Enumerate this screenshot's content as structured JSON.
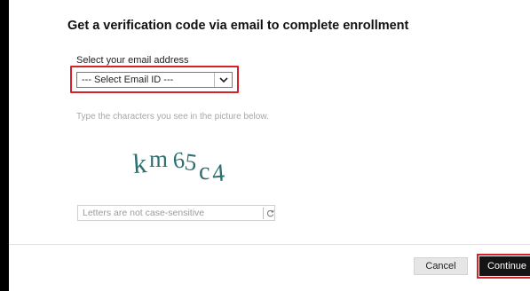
{
  "heading": "Get a verification code via email to complete enrollment",
  "email_select": {
    "label": "Select your email address",
    "selected": "--- Select Email ID ---",
    "caret_icon": "chevron-down-icon"
  },
  "captcha": {
    "instruction": "Type the characters you see in the picture below.",
    "image_text": "km65c4",
    "input_placeholder": "Letters are not case-sensitive",
    "refresh_icon": "refresh-icon"
  },
  "actions": {
    "cancel_label": "Cancel",
    "continue_label": "Continue"
  },
  "colors": {
    "highlight": "#d6202a",
    "captcha_text": "#2f6f6f",
    "primary_button": "#141414"
  }
}
